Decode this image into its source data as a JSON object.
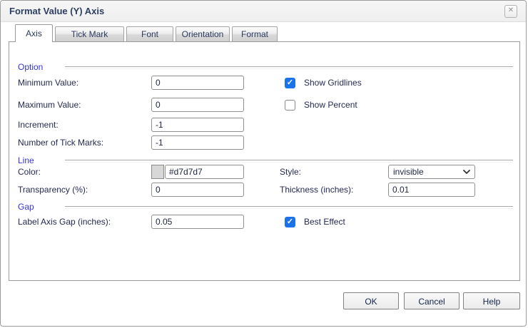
{
  "window": {
    "title": "Format Value (Y) Axis",
    "close_glyph": "✕"
  },
  "tabs": [
    {
      "label": "Axis",
      "active": true
    },
    {
      "label": "Tick Mark",
      "active": false
    },
    {
      "label": "Font",
      "active": false
    },
    {
      "label": "Orientation",
      "active": false
    },
    {
      "label": "Format",
      "active": false
    }
  ],
  "option": {
    "heading": "Option",
    "minimum_value": {
      "label": "Minimum Value:",
      "value": "0"
    },
    "maximum_value": {
      "label": "Maximum Value:",
      "value": "0"
    },
    "increment": {
      "label": "Increment:",
      "value": "-1"
    },
    "number_of_tick_marks": {
      "label": "Number of Tick Marks:",
      "value": "-1"
    },
    "show_gridlines": {
      "label": "Show Gridlines",
      "checked": true
    },
    "show_percent": {
      "label": "Show Percent",
      "checked": false
    }
  },
  "line": {
    "heading": "Line",
    "color": {
      "label": "Color:",
      "value": "#d7d7d7",
      "swatch_color": "#d7d7d7"
    },
    "style": {
      "label": "Style:",
      "selected": "invisible"
    },
    "transparency": {
      "label": "Transparency (%):",
      "value": "0"
    },
    "thickness": {
      "label": "Thickness (inches):",
      "value": "0.01"
    }
  },
  "gap": {
    "heading": "Gap",
    "label_axis_gap": {
      "label": "Label Axis Gap (inches):",
      "value": "0.05"
    },
    "best_effect": {
      "label": "Best Effect",
      "checked": true
    }
  },
  "buttons": {
    "ok": "OK",
    "cancel": "Cancel",
    "help": "Help"
  },
  "colors": {
    "checkbox_accent": "#1a73e8",
    "section_heading": "#3535d3",
    "line_color_swatch": "#d7d7d7"
  }
}
